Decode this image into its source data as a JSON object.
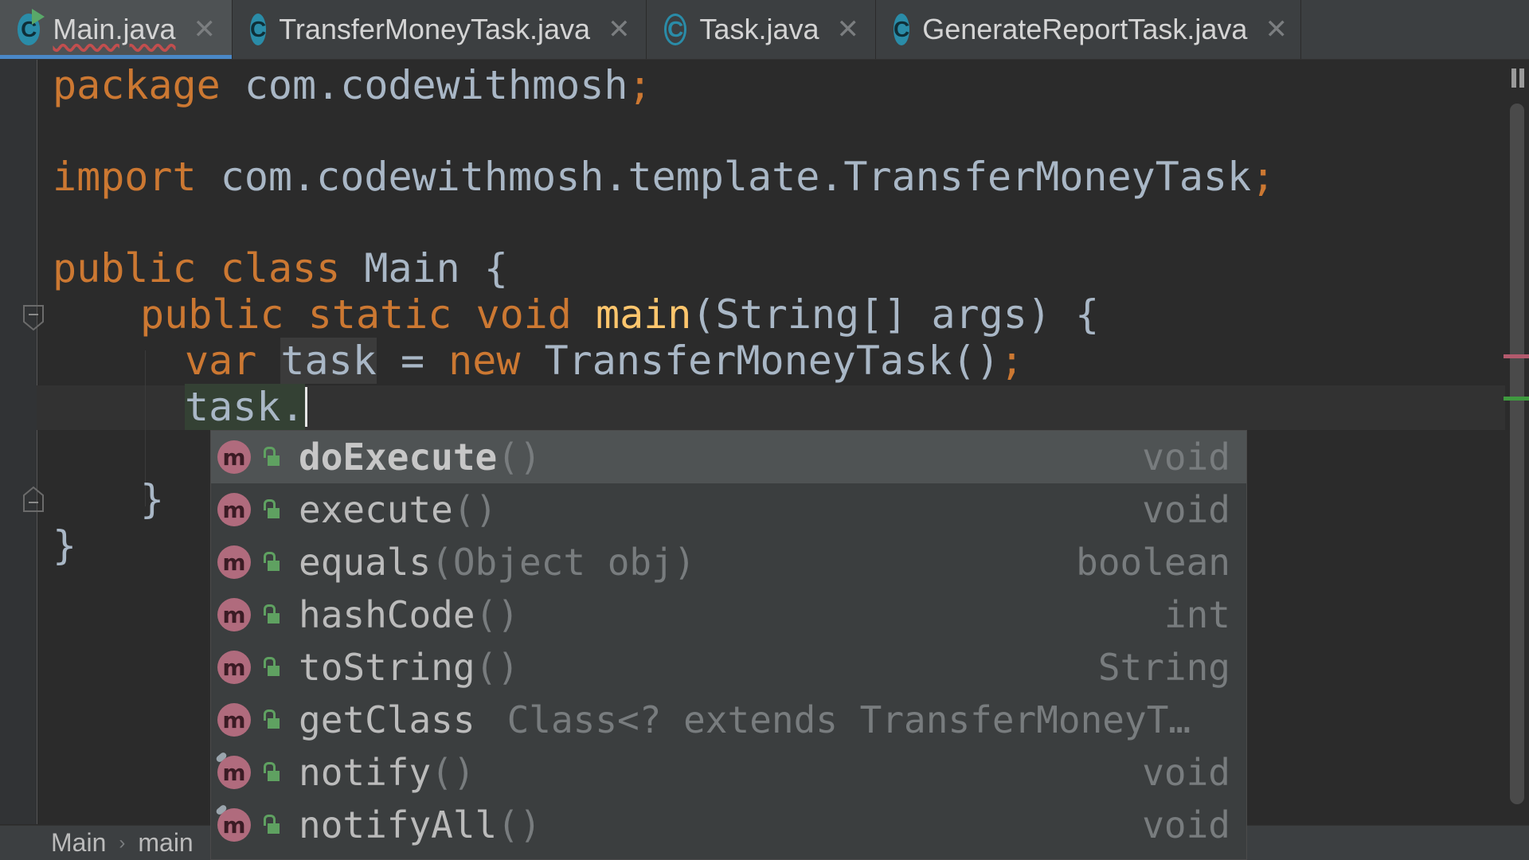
{
  "tabs": [
    {
      "label": "Main.java",
      "icon": "class-run-icon",
      "active": true
    },
    {
      "label": "TransferMoneyTask.java",
      "icon": "class-icon"
    },
    {
      "label": "Task.java",
      "icon": "abstract-class-icon"
    },
    {
      "label": "GenerateReportTask.java",
      "icon": "class-icon"
    }
  ],
  "tab_icon_letter": "C",
  "tab_close_glyph": "✕",
  "code": {
    "line1": {
      "kw": "package",
      "rest": " com.codewithmosh",
      "semi": ";"
    },
    "line2": {
      "kw": "import",
      "rest": " com.codewithmosh.template.TransferMoneyTask",
      "semi": ";"
    },
    "line3": {
      "kw1": "public",
      "kw2": "class",
      "rest": " Main {"
    },
    "line4": {
      "kw1": "public",
      "kw2": "static",
      "kw3": "void",
      "fn": "main",
      "rest": "(String[] args) {"
    },
    "line5": {
      "kw": "var",
      "var": "task",
      "eq": " = ",
      "kw2": "new",
      "rest": " TransferMoneyTask()",
      "semi": ";"
    },
    "line6": {
      "text": "task."
    },
    "line7": {
      "text": "}"
    },
    "line8": {
      "text": "}"
    }
  },
  "completion": {
    "icon_letter": "m",
    "items": [
      {
        "name": "doExecute",
        "params": "()",
        "type": "void",
        "selected": true
      },
      {
        "name": "execute",
        "params": "()",
        "type": "void"
      },
      {
        "name": "equals",
        "params": "(Object obj)",
        "type": "boolean"
      },
      {
        "name": "hashCode",
        "params": "()",
        "type": "int"
      },
      {
        "name": "toString",
        "params": "()",
        "type": "String"
      },
      {
        "name": "getClass",
        "params": "Class<? extends TransferMoneyT…",
        "type": ""
      },
      {
        "name": "notify",
        "params": "()",
        "type": "void",
        "final": true
      },
      {
        "name": "notifyAll",
        "params": "()",
        "type": "void",
        "final": true
      }
    ]
  },
  "breadcrumb": {
    "items": [
      "Main",
      "main"
    ],
    "separator": "›"
  },
  "colors": {
    "keyword": "#cc7832",
    "function": "#ffc66d",
    "text": "#a9b7c6",
    "accent": "#4a88c7",
    "method_icon": "#b06b7d"
  }
}
